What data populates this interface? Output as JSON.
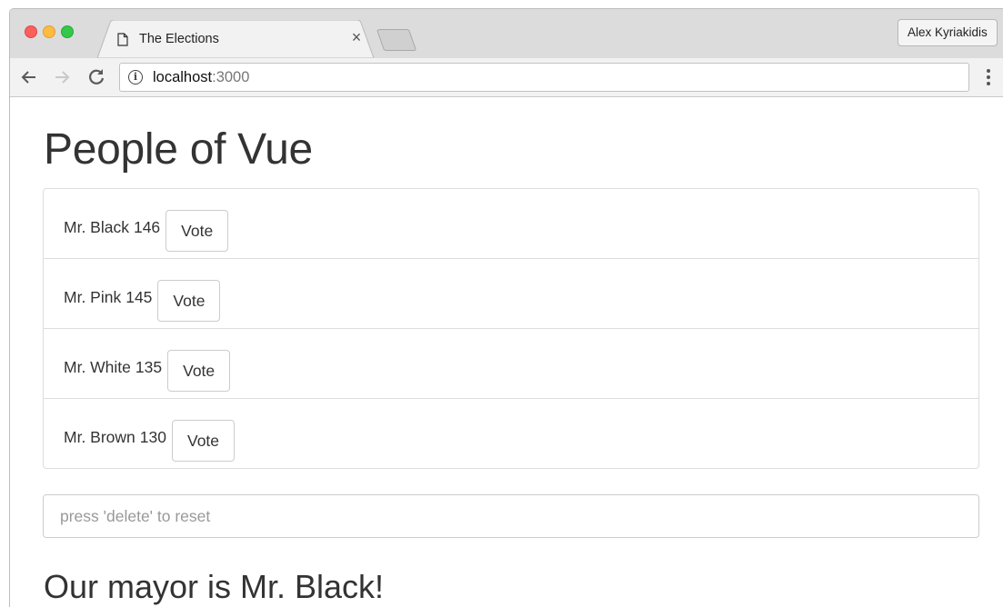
{
  "browser": {
    "tab_title": "The Elections",
    "tab_close": "×",
    "profile_name": "Alex Kyriakidis",
    "url_host": "localhost",
    "url_port": ":3000",
    "info_glyph": "i"
  },
  "icons": {
    "back": "back-arrow-icon",
    "forward": "forward-arrow-icon",
    "reload": "reload-icon",
    "info": "info-icon",
    "page": "page-icon",
    "menu": "menu-dots-icon"
  },
  "page": {
    "title": "People of Vue",
    "candidates": [
      {
        "name": "Mr. Black",
        "votes": "146",
        "vote_label": "Vote"
      },
      {
        "name": "Mr. Pink",
        "votes": "145",
        "vote_label": "Vote"
      },
      {
        "name": "Mr. White",
        "votes": "135",
        "vote_label": "Vote"
      },
      {
        "name": "Mr. Brown",
        "votes": "130",
        "vote_label": "Vote"
      }
    ],
    "reset_placeholder": "press 'delete' to reset",
    "reset_value": "",
    "mayor_text": "Our mayor is Mr. Black!"
  },
  "colors": {
    "close": "#fc605c",
    "minimize": "#fdbc40",
    "maximize": "#34c84a",
    "text": "#333333"
  }
}
